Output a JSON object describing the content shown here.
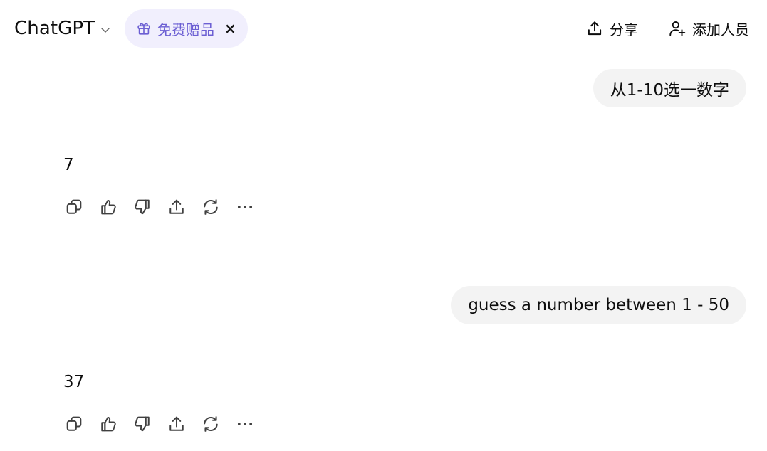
{
  "header": {
    "model_name": "ChatGPT",
    "gift_label": "免费赠品",
    "gift_close": "×",
    "share_label": "分享",
    "add_people_label": "添加人员"
  },
  "conversation": [
    {
      "role": "user",
      "text": "从1-10选一数字"
    },
    {
      "role": "assistant",
      "text": "7"
    },
    {
      "role": "user",
      "text": "guess a number between 1 - 50"
    },
    {
      "role": "assistant",
      "text": "37"
    }
  ],
  "icons": {
    "model_chevron": "chevron-down-icon",
    "gift": "gift-icon",
    "share": "share-upload-icon",
    "add_people": "add-person-icon",
    "message_actions": [
      "copy-icon",
      "thumbs-up-icon",
      "thumbs-down-icon",
      "share-icon",
      "regenerate-icon",
      "more-icon"
    ]
  },
  "colors": {
    "gift_pill_bg": "#f1effd",
    "gift_accent": "#6c5fd3",
    "user_bubble_bg": "#f3f3f3",
    "text": "#0d0d0d",
    "icon_stroke": "#404040"
  }
}
